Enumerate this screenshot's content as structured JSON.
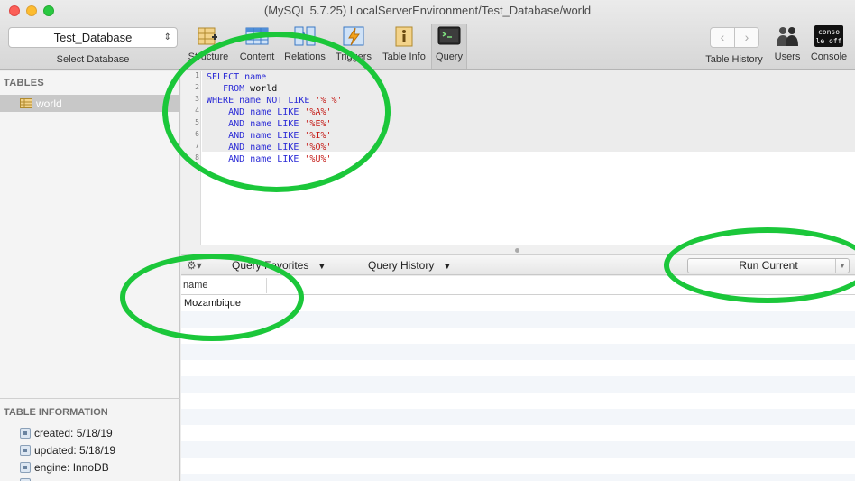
{
  "window": {
    "title": "(MySQL 5.7.25) LocalServerEnvironment/Test_Database/world"
  },
  "toolbar": {
    "database_select": {
      "value": "Test_Database",
      "label": "Select Database"
    },
    "tools": [
      {
        "label": "Structure",
        "icon": "structure-icon"
      },
      {
        "label": "Content",
        "icon": "content-icon"
      },
      {
        "label": "Relations",
        "icon": "relations-icon"
      },
      {
        "label": "Triggers",
        "icon": "triggers-icon"
      },
      {
        "label": "Table Info",
        "icon": "table-info-icon"
      },
      {
        "label": "Query",
        "icon": "query-icon",
        "active": true
      }
    ],
    "right_tools": [
      {
        "label": "Table History",
        "icon": "history-nav-icon"
      },
      {
        "label": "Users",
        "icon": "users-icon"
      },
      {
        "label": "Console",
        "icon": "console-icon",
        "badge_lines": [
          "conso",
          "le off"
        ]
      }
    ]
  },
  "sidebar": {
    "tables_heading": "TABLES",
    "tables": [
      {
        "name": "world",
        "selected": true
      }
    ],
    "info_heading": "TABLE INFORMATION",
    "info": [
      "created: 5/18/19",
      "updated: 5/18/19",
      "engine: InnoDB"
    ]
  },
  "editor": {
    "line_numbers": [
      "1",
      "2",
      "3",
      "4",
      "5",
      "6",
      "7",
      "8"
    ],
    "lines": [
      [
        {
          "t": "kw",
          "v": "SELECT "
        },
        {
          "t": "kw",
          "v": "name"
        }
      ],
      [
        {
          "t": "id",
          "v": "   "
        },
        {
          "t": "kw",
          "v": "FROM "
        },
        {
          "t": "id",
          "v": "world"
        }
      ],
      [
        {
          "t": "kw",
          "v": "WHERE "
        },
        {
          "t": "kw",
          "v": "name "
        },
        {
          "t": "kw",
          "v": "NOT LIKE "
        },
        {
          "t": "str",
          "v": "'% %'"
        }
      ],
      [
        {
          "t": "id",
          "v": "    "
        },
        {
          "t": "kw",
          "v": "AND "
        },
        {
          "t": "kw",
          "v": "name "
        },
        {
          "t": "kw",
          "v": "LIKE "
        },
        {
          "t": "str",
          "v": "'%A%'"
        }
      ],
      [
        {
          "t": "id",
          "v": "    "
        },
        {
          "t": "kw",
          "v": "AND "
        },
        {
          "t": "kw",
          "v": "name "
        },
        {
          "t": "kw",
          "v": "LIKE "
        },
        {
          "t": "str",
          "v": "'%E%'"
        }
      ],
      [
        {
          "t": "id",
          "v": "    "
        },
        {
          "t": "kw",
          "v": "AND "
        },
        {
          "t": "kw",
          "v": "name "
        },
        {
          "t": "kw",
          "v": "LIKE "
        },
        {
          "t": "str",
          "v": "'%I%'"
        }
      ],
      [
        {
          "t": "id",
          "v": "    "
        },
        {
          "t": "kw",
          "v": "AND "
        },
        {
          "t": "kw",
          "v": "name "
        },
        {
          "t": "kw",
          "v": "LIKE "
        },
        {
          "t": "str",
          "v": "'%O%'"
        }
      ],
      [
        {
          "t": "id",
          "v": "    "
        },
        {
          "t": "kw",
          "v": "AND "
        },
        {
          "t": "kw",
          "v": "name "
        },
        {
          "t": "kw",
          "v": "LIKE "
        },
        {
          "t": "str",
          "v": "'%U%'"
        }
      ]
    ]
  },
  "query_bar": {
    "favorites_label": "Query Favorites",
    "history_label": "Query History",
    "run_label": "Run Current"
  },
  "results": {
    "columns": [
      "name"
    ],
    "rows": [
      [
        "Mozambique"
      ]
    ]
  },
  "colors": {
    "annotation_ring": "#1bc73a",
    "keyword": "#2b2bd6",
    "string": "#c41a16"
  }
}
